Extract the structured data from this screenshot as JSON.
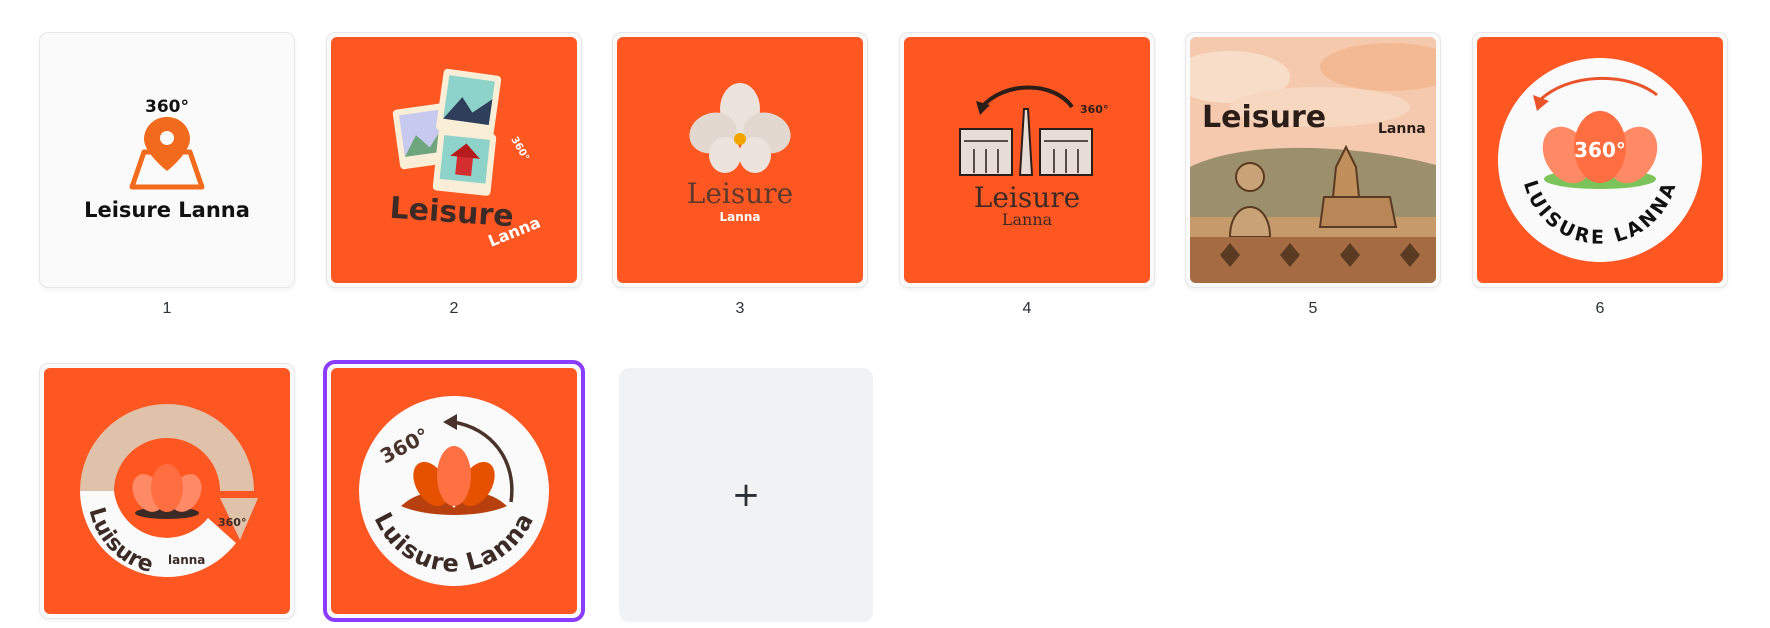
{
  "pages": [
    {
      "number": "1",
      "title": "Leisure Lanna",
      "badge": "360°"
    },
    {
      "number": "2",
      "title": "Leisure",
      "subtitle": "Lanna",
      "badge": "360°"
    },
    {
      "number": "3",
      "title": "Leisure",
      "subtitle": "Lanna"
    },
    {
      "number": "4",
      "title": "Leisure",
      "subtitle": "Lanna",
      "badge": "360°"
    },
    {
      "number": "5",
      "title": "Leisure",
      "subtitle": "Lanna"
    },
    {
      "number": "6",
      "title": "LUISURE LANNA",
      "badge": "360°"
    },
    {
      "number": "7",
      "title": "Luisure",
      "subtitle": "lanna",
      "badge": "360°"
    },
    {
      "number": "8",
      "title": "Luisure Lanna",
      "badge": "360°",
      "selected": true
    }
  ],
  "add_page": {
    "icon": "plus-icon",
    "label": "+"
  },
  "colors": {
    "brand_orange": "#FF5722",
    "selection": "#8B3DFF",
    "dark_text": "#3b2a26"
  }
}
